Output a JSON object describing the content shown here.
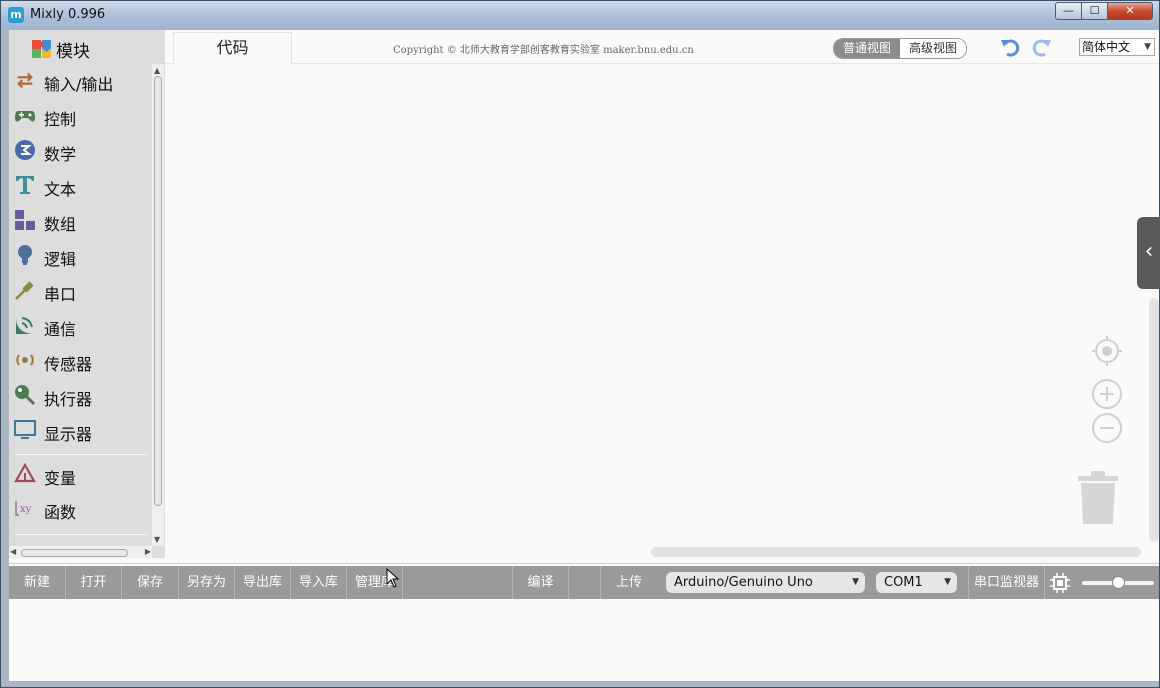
{
  "window": {
    "title": "Mixly 0.996",
    "icon_glyph": "m",
    "controls": {
      "minimize": "—",
      "maximize": "☐",
      "close": "✕"
    }
  },
  "sidebar": {
    "header": "模块",
    "categories": [
      {
        "label": "输入/输出",
        "icon": "arrows-icon",
        "color": "#b06a3a"
      },
      {
        "label": "控制",
        "icon": "gamepad-icon",
        "color": "#4f7b52"
      },
      {
        "label": "数学",
        "icon": "math-icon",
        "color": "#4a6aa8"
      },
      {
        "label": "文本",
        "icon": "text-icon",
        "color": "#3d8f9a"
      },
      {
        "label": "数组",
        "icon": "array-icon",
        "color": "#6a5aa0"
      },
      {
        "label": "逻辑",
        "icon": "bulb-icon",
        "color": "#4d7196"
      },
      {
        "label": "串口",
        "icon": "serial-icon",
        "color": "#8a8a3a"
      },
      {
        "label": "通信",
        "icon": "comm-icon",
        "color": "#3b7a6a"
      },
      {
        "label": "传感器",
        "icon": "sensor-icon",
        "color": "#a07a3a"
      },
      {
        "label": "执行器",
        "icon": "actuator-icon",
        "color": "#4f7b52"
      },
      {
        "label": "显示器",
        "icon": "monitor-icon",
        "color": "#3b7a9a"
      },
      {
        "label": "变量",
        "icon": "variable-icon",
        "color": "#a04a5a"
      },
      {
        "label": "函数",
        "icon": "function-icon",
        "color": "#8a5a9a"
      }
    ]
  },
  "topbar": {
    "code_tab": "代码",
    "copyright": "Copyright © 北师大教育学部创客教育实验室 maker.bnu.edu.cn",
    "view_normal": "普通视图",
    "view_advanced": "高级视图",
    "language": "简体中文"
  },
  "toolbar": {
    "new": "新建",
    "open": "打开",
    "save": "保存",
    "save_as": "另存为",
    "export_lib": "导出库",
    "import_lib": "导入库",
    "manage_lib": "管理库",
    "compile": "编译",
    "upload": "上传",
    "board": "Arduino/Genuino Uno",
    "port": "COM1",
    "serial_monitor": "串口监视器"
  },
  "colors": {
    "toolbar_bg": "#9a9a9a",
    "sidebar_bg": "#dddddd",
    "workspace_bg": "#fafaf9",
    "accent": "#5a8fd6"
  }
}
